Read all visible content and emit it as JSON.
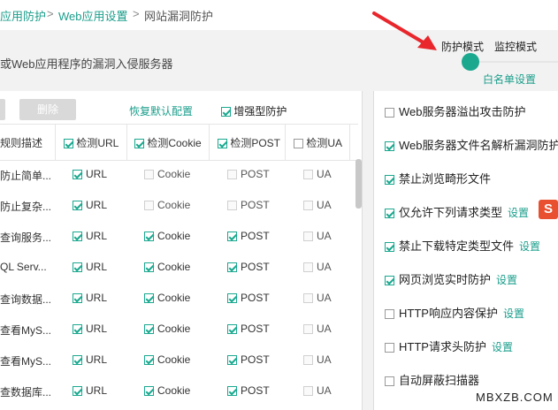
{
  "breadcrumb": {
    "item1": "应用防护",
    "sep1": ">",
    "item2": "Web应用设置",
    "sep2": ">",
    "item3": "网站漏洞防护"
  },
  "description": "或Web应用程序的漏洞入侵服务器",
  "mode": {
    "protect": "防护模式",
    "monitor": "监控模式",
    "whitelist": "白名单设置",
    "slider_position": "protect"
  },
  "toolbar": {
    "delete": "删除",
    "restore": "恢复默认配置",
    "enhanced": "增强型防护",
    "enhanced_checked": true
  },
  "table": {
    "headers": {
      "desc": "规则描述",
      "url": "检测URL",
      "cookie": "检测Cookie",
      "post": "检测POST",
      "ua": "检测UA"
    },
    "header_checks": {
      "url": true,
      "cookie": true,
      "post": true,
      "ua": false
    },
    "rows": [
      {
        "desc": "防止简单...",
        "url": true,
        "cookie": false,
        "post": false,
        "ua": false
      },
      {
        "desc": "防止复杂...",
        "url": true,
        "cookie": false,
        "post": false,
        "ua": false
      },
      {
        "desc": "查询服务...",
        "url": true,
        "cookie": true,
        "post": true,
        "ua": false
      },
      {
        "desc": "QL Serv...",
        "url": true,
        "cookie": true,
        "post": true,
        "ua": false
      },
      {
        "desc": "查询数据...",
        "url": true,
        "cookie": true,
        "post": true,
        "ua": false
      },
      {
        "desc": "查看MyS...",
        "url": true,
        "cookie": true,
        "post": true,
        "ua": false
      },
      {
        "desc": "查看MyS...",
        "url": true,
        "cookie": true,
        "post": true,
        "ua": false
      },
      {
        "desc": "查数据库...",
        "url": true,
        "cookie": true,
        "post": true,
        "ua": false
      }
    ],
    "labels": {
      "url": "URL",
      "cookie": "Cookie",
      "post": "POST",
      "ua": "UA"
    }
  },
  "right_items": [
    {
      "label": "Web服务器溢出攻击防护",
      "checked": false,
      "setting": ""
    },
    {
      "label": "Web服务器文件名解析漏洞防护",
      "checked": true,
      "setting": ""
    },
    {
      "label": "禁止浏览畸形文件",
      "checked": true,
      "setting": ""
    },
    {
      "label": "仅允许下列请求类型",
      "checked": true,
      "setting": "设置"
    },
    {
      "label": "禁止下载特定类型文件",
      "checked": true,
      "setting": "设置"
    },
    {
      "label": "网页浏览实时防护",
      "checked": true,
      "setting": "设置"
    },
    {
      "label": "HTTP响应内容保护",
      "checked": false,
      "setting": "设置"
    },
    {
      "label": "HTTP请求头防护",
      "checked": false,
      "setting": "设置"
    },
    {
      "label": "自动屏蔽扫描器",
      "checked": false,
      "setting": ""
    }
  ],
  "badge": "S",
  "watermark": "MBXZB.COM",
  "colors": {
    "accent": "#1aa88f",
    "link": "#1a9e8b",
    "arrow": "#e8262c",
    "badge": "#e8502f"
  }
}
